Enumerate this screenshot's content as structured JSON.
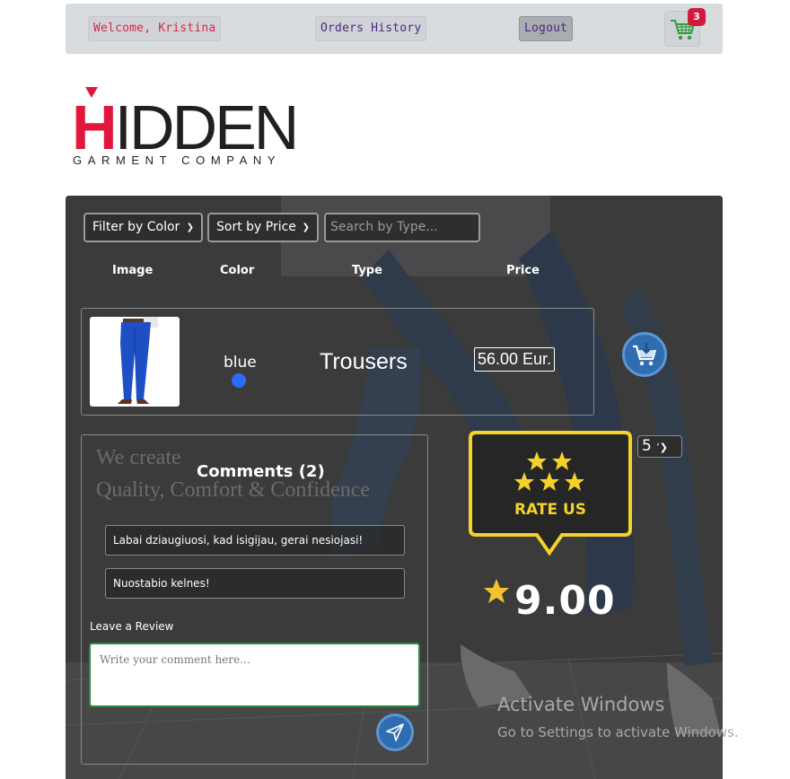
{
  "nav": {
    "welcome": "Welcome, Kristina",
    "orders": "Orders History",
    "logout": "Logout",
    "cart_count": "3"
  },
  "logo": {
    "first_letter": "H",
    "rest": "IDDEN",
    "subtitle": "GARMENT COMPANY"
  },
  "filters": {
    "color_label": "Filter by Color",
    "sort_label": "Sort by Price",
    "search_placeholder": "Search by Type..."
  },
  "columns": [
    "Image",
    "Color",
    "Type",
    "Price"
  ],
  "product": {
    "color_name": "blue",
    "color_hex": "#2c6bff",
    "type": "Trousers",
    "price": "56.00 Eur."
  },
  "comments": {
    "tagline_line1": "We create",
    "tagline_line2": "Quality, Comfort & Confidence",
    "title": "Comments (2)",
    "items": [
      "Labai dziaugiuosi, kad isigijau, gerai nesiojasi!",
      "Nuostabio kelnes!"
    ],
    "leave_label": "Leave a Review",
    "placeholder": "Write your comment here..."
  },
  "rating": {
    "badge_text": "RATE US",
    "select_value": "5",
    "score": "9.00"
  },
  "watermark": {
    "line1": "Activate Windows",
    "line2": "Go to Settings to activate Windows."
  },
  "colors": {
    "accent_red": "#e0183b",
    "badge_yellow": "#f5d22a",
    "button_blue": "#2e6db0"
  }
}
